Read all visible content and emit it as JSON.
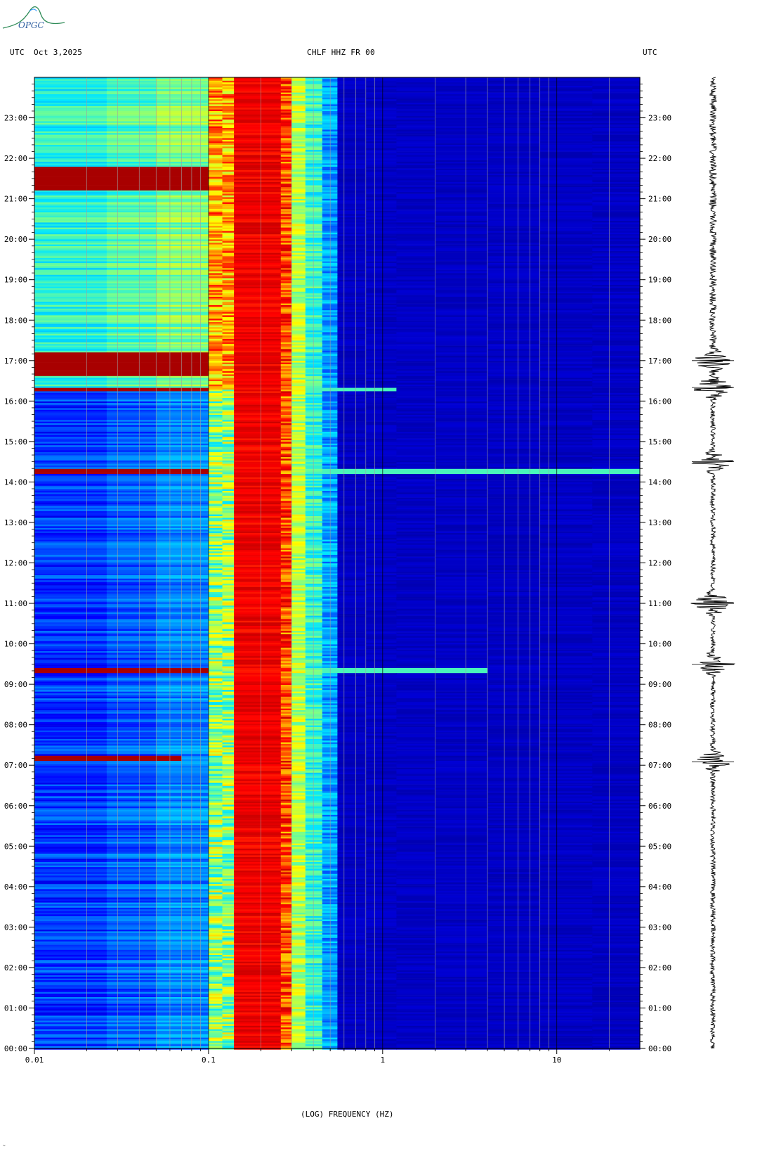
{
  "header": {
    "left_tz": "UTC",
    "date": "Oct 3,2025",
    "station": "CHLF HHZ FR 00",
    "right_tz": "UTC",
    "logo_text": "OPGC"
  },
  "colors": {
    "background": "#0000a8",
    "low": "#0c3ef5",
    "cyan": "#16c8ff",
    "yellow": "#ffff30",
    "orange": "#ff8000",
    "red": "#e00000",
    "dark_red": "#8c0000",
    "gridline": "#a0a0a0"
  },
  "chart_data": {
    "type": "heatmap",
    "title": "CHLF HHZ FR 00",
    "xlabel": "(LOG) FREQUENCY (HZ)",
    "ylabel": "UTC",
    "x_scale": "log",
    "xlim": [
      0.01,
      30
    ],
    "ylim_hours": [
      0,
      24
    ],
    "x_ticks": [
      "0.01",
      "0.1",
      "1",
      "10"
    ],
    "y_ticks": [
      "00:00",
      "01:00",
      "02:00",
      "03:00",
      "04:00",
      "05:00",
      "06:00",
      "07:00",
      "08:00",
      "09:00",
      "10:00",
      "11:00",
      "12:00",
      "13:00",
      "14:00",
      "15:00",
      "16:00",
      "17:00",
      "18:00",
      "19:00",
      "20:00",
      "21:00",
      "22:00",
      "23:00"
    ],
    "microseism_band_hz": [
      0.14,
      0.3
    ],
    "elevated_noise_hours": [
      16.3,
      24
    ],
    "events": [
      {
        "time": "07:10",
        "max_freq_hz": 0.07
      },
      {
        "time": "09:20",
        "max_freq_hz": 5
      },
      {
        "time": "14:15",
        "max_freq_hz": 25
      },
      {
        "time": "16:17",
        "max_freq_hz": 1
      },
      {
        "time": "16:55",
        "max_freq_hz": 0.1
      },
      {
        "time": "21:30",
        "max_freq_hz": 0.1
      }
    ],
    "seismogram_bursts": [
      "07:05",
      "09:30",
      "11:00",
      "14:30",
      "16:20",
      "17:00"
    ]
  }
}
